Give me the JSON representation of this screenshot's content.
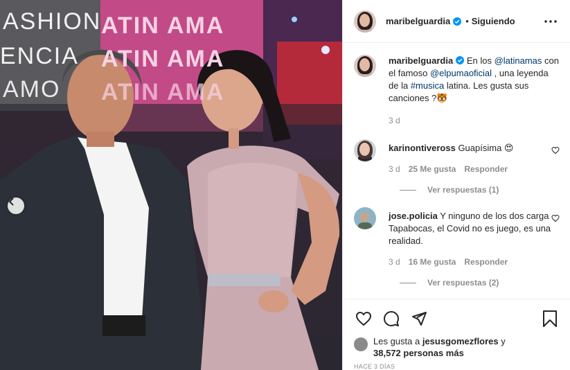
{
  "photo": {
    "background_signage": [
      "ASHION",
      "ENCIA",
      "AMO",
      "ATIN AMA",
      "ATIN AMA",
      "ATIN AMA"
    ]
  },
  "post": {
    "username": "maribelguardia",
    "follow_status": "Siguiendo",
    "separator": "•"
  },
  "caption": {
    "username": "maribelguardia",
    "text_1": " En los ",
    "mention_1": "@latinamas",
    "text_2": " con el famoso ",
    "mention_2": "@elpumaoficial",
    "text_3": " , una leyenda de la ",
    "hashtag": "#musica",
    "text_4": " latina. Les gusta sus canciones ?🐯",
    "time": "3 d"
  },
  "comments": [
    {
      "username": "karinontiveross",
      "text": " Guapísima 😍",
      "time": "3 d",
      "likes": "25 Me gusta",
      "reply": "Responder",
      "view_replies": "Ver respuestas (1)"
    },
    {
      "username": "jose.policia",
      "text": " Y ninguno de los dos carga Tapabocas, el Covid no es juego, es una realidad.",
      "time": "3 d",
      "likes": "16 Me gusta",
      "reply": "Responder",
      "view_replies": "Ver respuestas (2)"
    }
  ],
  "likes_summary": {
    "prefix": "Les gusta a ",
    "user": "jesusgomezflores",
    "mid": " y",
    "count": "38,572 personas más"
  },
  "posted_ago": "HACE 3 DÍAS",
  "icons": {
    "like": "heart-icon",
    "comment": "comment-icon",
    "share": "send-icon",
    "save": "bookmark-icon",
    "more": "more-options-icon",
    "verified": "verified-badge-icon",
    "carousel": "chevron-left-icon"
  },
  "colors": {
    "link": "#00376b",
    "verified": "#0095f6",
    "meta_gray": "#8e8e8e"
  }
}
